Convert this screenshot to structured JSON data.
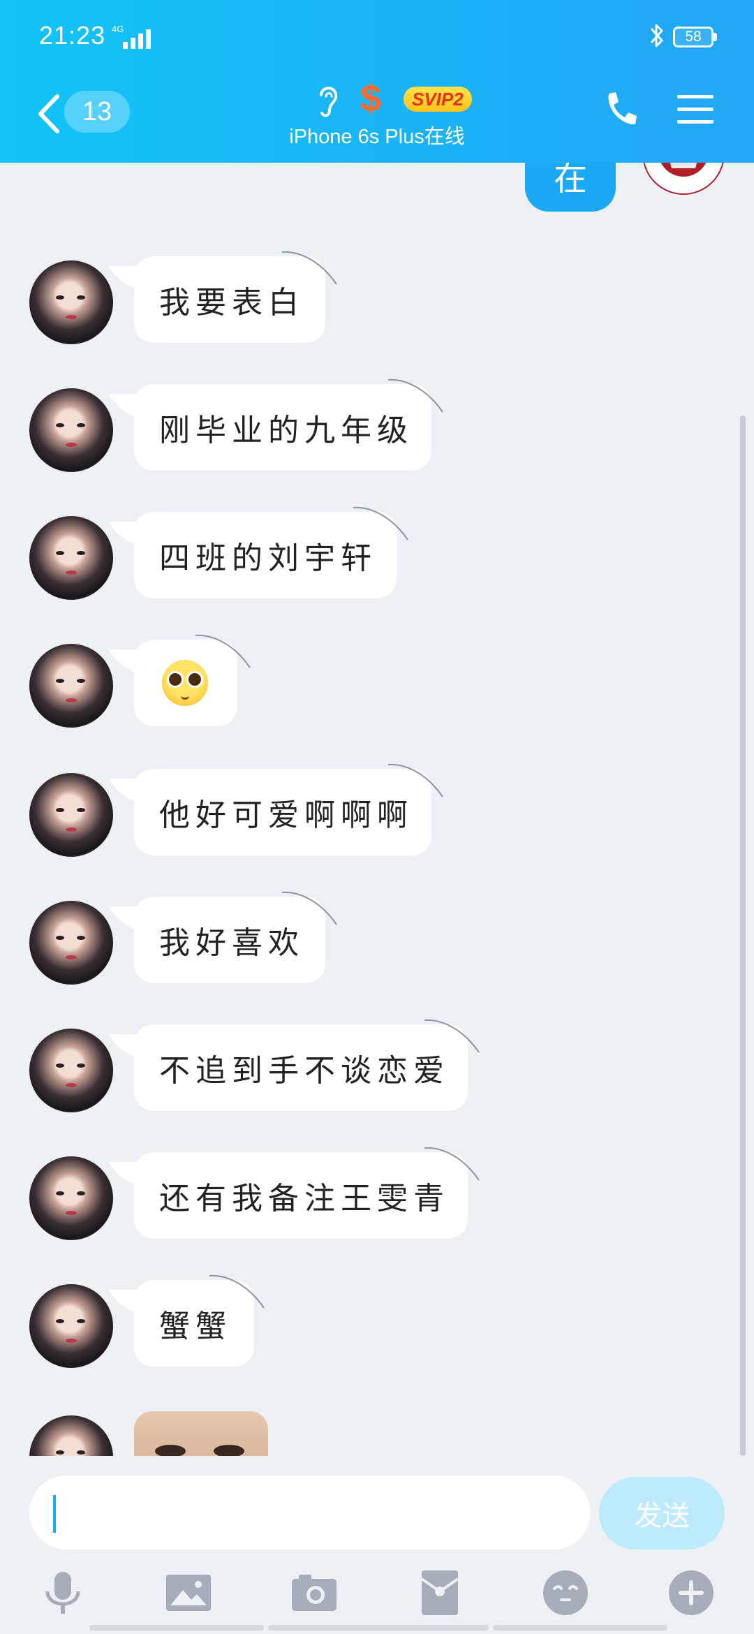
{
  "status_bar": {
    "time": "21:23",
    "network": "4G",
    "battery": "58"
  },
  "title_bar": {
    "unread_count": "13",
    "vip_badge": "SVIP2",
    "online_status": "iPhone 6s Plus在线",
    "icons": [
      "back-chevron-icon",
      "ear-icon",
      "dollar-icon",
      "phone-icon",
      "menu-icon"
    ]
  },
  "colors": {
    "header": "#1BB3F6",
    "sent_bubble": "#1BA8F4",
    "send_button": "#BDEBFB",
    "background": "#EDF0F5"
  },
  "chat": {
    "sent_partial": "在",
    "messages": [
      "我要表白",
      "刚毕业的九年级",
      "四班的刘宇轩",
      "",
      "他好可爱啊啊啊",
      "我好喜欢",
      "不追到手不谈恋爱",
      "还有我备注王雯青",
      "蟹蟹"
    ],
    "emoji_message": "pleading-face-emoji"
  },
  "input": {
    "value": "",
    "placeholder": "",
    "send_label": "发送"
  },
  "toolbar": {
    "items": [
      "microphone-icon",
      "image-icon",
      "camera-icon",
      "red-packet-icon",
      "emoji-icon",
      "plus-icon"
    ]
  }
}
